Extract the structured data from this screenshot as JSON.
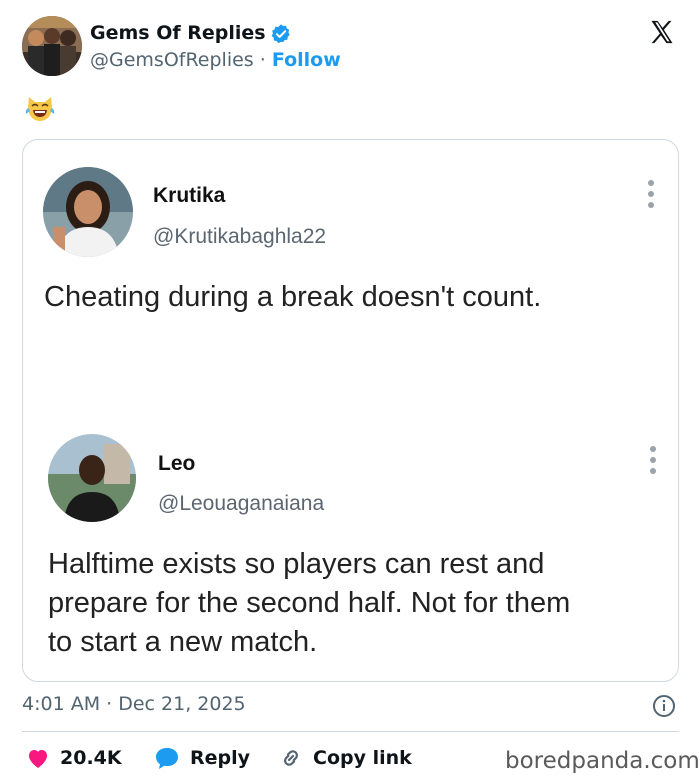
{
  "author": {
    "name": "Gems Of Replies",
    "handle": "@GemsOfReplies",
    "separator": "·",
    "follow_label": "Follow"
  },
  "icons": {
    "verified": "verified-badge-icon",
    "brand": "x-logo-icon",
    "emoji": "laughing-cat-emoji",
    "more": "kebab-menu-icon",
    "info": "info-icon",
    "like": "heart-icon",
    "reply": "speech-bubble-icon",
    "copy": "link-icon"
  },
  "quoted": {
    "first": {
      "name": "Krutika",
      "handle": "@Krutikabaghla22",
      "text": "Cheating during a break doesn't count."
    },
    "second": {
      "name": "Leo",
      "handle": "@Leouaganaiana",
      "text_lines": [
        "Halftime exists so players can rest and",
        "prepare for the second half. Not for them",
        "to start a new match."
      ]
    }
  },
  "meta": {
    "timestamp": "4:01 AM · Dec 21, 2025"
  },
  "actions": {
    "likes": "20.4K",
    "reply_label": "Reply",
    "copy_label": "Copy link"
  },
  "watermark": "boredpanda.com",
  "colors": {
    "accent": "#1d9bf0",
    "like": "#f91880",
    "text": "#0f1419",
    "muted": "#536471",
    "border": "#cfd9de"
  }
}
